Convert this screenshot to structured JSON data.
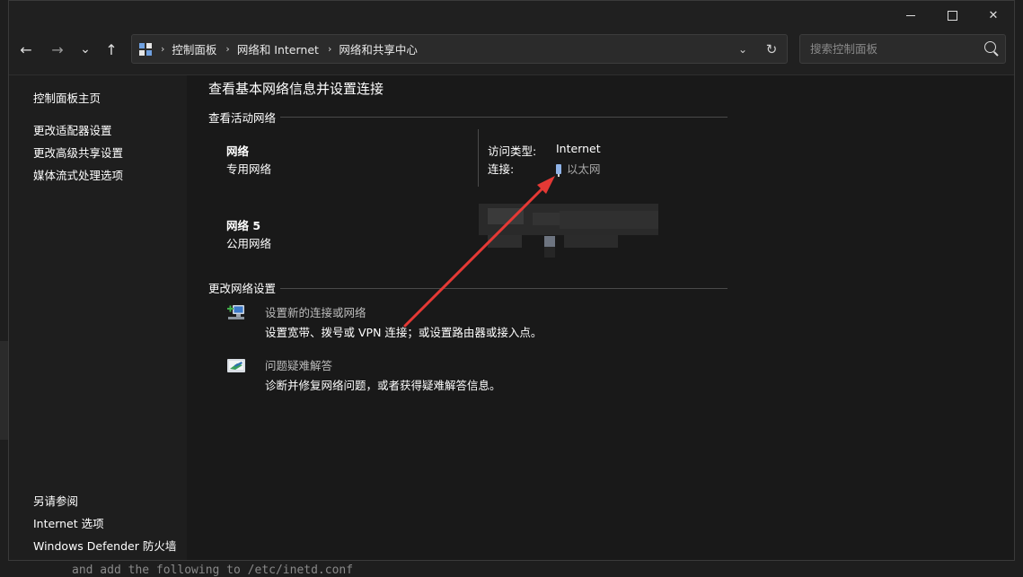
{
  "window": {
    "minimize_label": "—",
    "maximize_label": "☐",
    "close_label": "✕"
  },
  "nav": {
    "back": "←",
    "forward": "→",
    "recent": "⌄",
    "up": "↑"
  },
  "address": {
    "crumbs": [
      "控制面板",
      "网络和 Internet",
      "网络和共享中心"
    ],
    "separator": "›"
  },
  "search": {
    "placeholder": "搜索控制面板"
  },
  "sidebar": {
    "top_links": [
      "控制面板主页",
      "更改适配器设置",
      "更改高级共享设置",
      "媒体流式处理选项"
    ],
    "see_also_title": "另请参阅",
    "see_also_links": [
      "Internet 选项",
      "Windows Defender 防火墙"
    ]
  },
  "main": {
    "title": "查看基本网络信息并设置连接",
    "active_networks_header": "查看活动网络",
    "networks": [
      {
        "name": "网络",
        "type": "专用网络",
        "access_label": "访问类型:",
        "access_value": "Internet",
        "connection_label": "连接:",
        "connection_value": "以太网"
      },
      {
        "name": "网络 5",
        "type": "公用网络"
      }
    ],
    "change_settings_header": "更改网络设置",
    "tasks": [
      {
        "link": "设置新的连接或网络",
        "desc": "设置宽带、拨号或 VPN 连接；或设置路由器或接入点。",
        "icon": "network-setup-icon"
      },
      {
        "link": "问题疑难解答",
        "desc": "诊断并修复网络问题，或者获得疑难解答信息。",
        "icon": "troubleshoot-icon"
      }
    ]
  },
  "background": {
    "code_text": "and add the following to /etc/inetd.conf"
  },
  "colors": {
    "accent_arrow": "#e53935",
    "window_bg": "#191919",
    "sidebar_bg": "#1e1e1e"
  }
}
